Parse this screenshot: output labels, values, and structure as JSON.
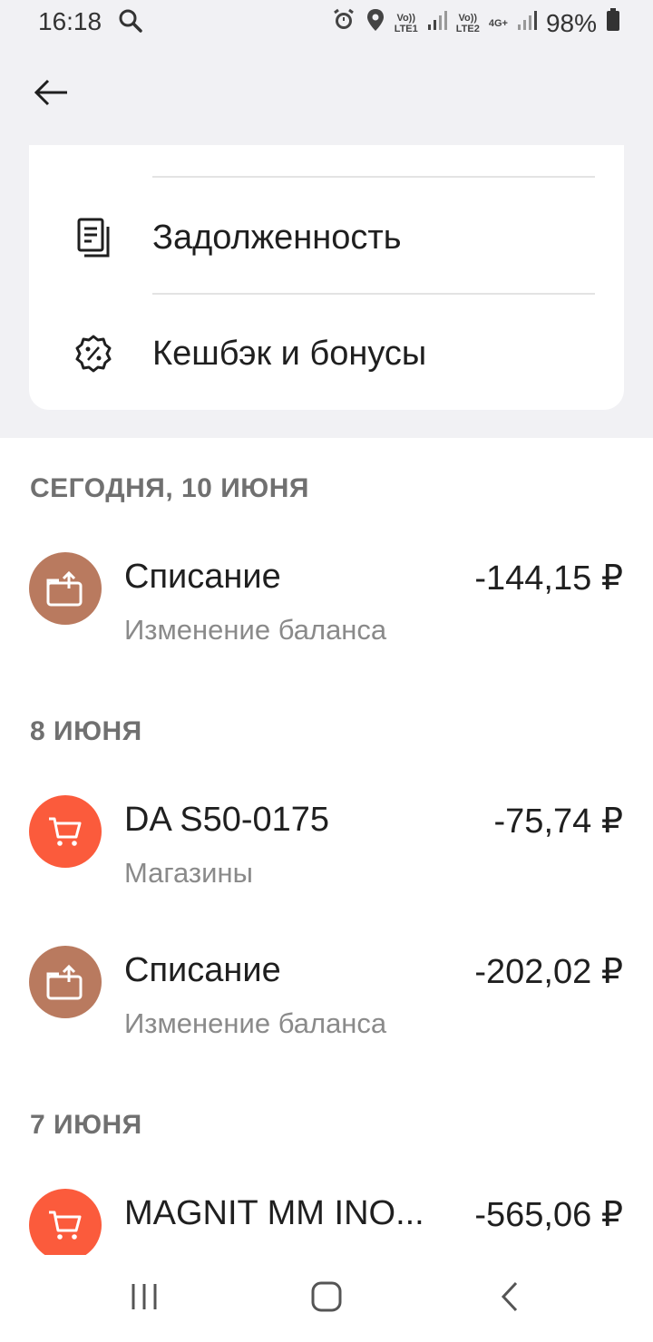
{
  "status_bar": {
    "time": "16:18",
    "lte1": "LTE1",
    "lte2": "LTE2",
    "volte": "Vo))",
    "net": "4G+",
    "battery": "98%"
  },
  "menu": {
    "items": [
      {
        "label": "Задолженность",
        "icon": "document-icon"
      },
      {
        "label": "Кешбэк и бонусы",
        "icon": "percent-badge-icon"
      }
    ]
  },
  "colors": {
    "balance_avatar": "#b97a5f",
    "shop_avatar": "#fb5b3c",
    "top_background": "#f1f1f4"
  },
  "groups": [
    {
      "date": "СЕГОДНЯ, 10 ИЮНЯ",
      "transactions": [
        {
          "title": "Списание",
          "subtitle": "Изменение баланса",
          "amount": "-144,15 ₽",
          "icon": "wallet-upload-icon"
        }
      ]
    },
    {
      "date": "8 ИЮНЯ",
      "transactions": [
        {
          "title": "DA S50-0175",
          "subtitle": "Магазины",
          "amount": "-75,74 ₽",
          "icon": "cart-icon"
        },
        {
          "title": "Списание",
          "subtitle": "Изменение баланса",
          "amount": "-202,02 ₽",
          "icon": "wallet-upload-icon"
        }
      ]
    },
    {
      "date": "7 ИЮНЯ",
      "transactions": [
        {
          "title": "MAGNIT MM INO...",
          "subtitle": "",
          "amount": "-565,06 ₽",
          "icon": "cart-icon"
        }
      ]
    }
  ]
}
